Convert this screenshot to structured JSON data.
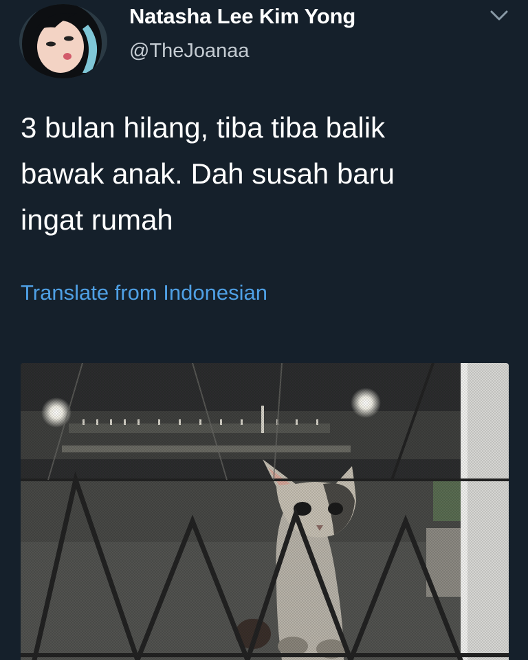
{
  "tweet": {
    "display_name": "Natasha Lee Kim Yong",
    "handle": "@TheJoanaa",
    "text": "3 bulan hilang, tiba tiba balik\nbawak anak. Dah susah baru\ningat rumah",
    "translate_label": "Translate from Indonesian",
    "avatar_icon": "user-avatar",
    "menu_icon": "chevron-down-icon"
  },
  "colors": {
    "background": "#15202b",
    "primary_text": "#ffffff",
    "secondary_text": "#c5ccd3",
    "link": "#4fa0e5"
  }
}
